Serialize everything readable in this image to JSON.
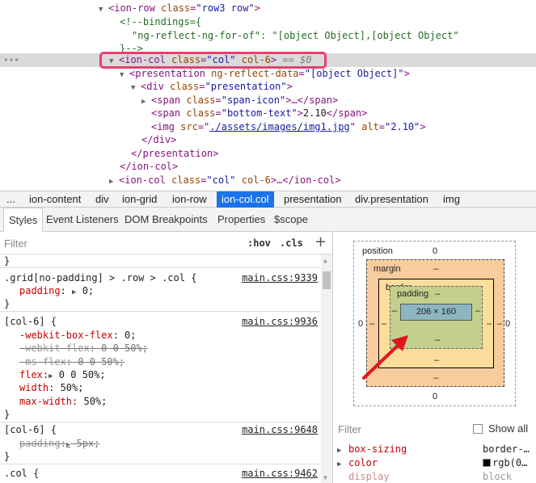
{
  "tree": {
    "lines": [
      {
        "tri": "▼",
        "t1": "<ion-row ",
        "a1n": "class",
        "a1v": "\"row3 row\"",
        "t2": ">"
      },
      {
        "c": "<!--bindings={"
      },
      {
        "c": "\"ng-reflect-ng-for-of\": \"[object Object],[object Object\""
      },
      {
        "c": "}-->"
      },
      {
        "tri": "▼",
        "t1": "<ion-col ",
        "a1n": "class",
        "a1v": "\"col\"",
        "a2n": " col-6",
        "t2": ">",
        "extra": " == $0"
      },
      {
        "tri": "▼",
        "t1": "<presentation ",
        "a1n": "ng-reflect-data",
        "a1v": "\"[object Object]\"",
        "t2": ">"
      },
      {
        "tri": "▼",
        "t1": "<div ",
        "a1n": "class",
        "a1v": "\"presentation\"",
        "t2": ">"
      },
      {
        "tri": "▶",
        "t1": "<span ",
        "a1n": "class",
        "a1v": "\"span-icon\"",
        "t2": ">…</span>"
      },
      {
        "t1": "<span ",
        "a1n": "class",
        "a1v": "\"bottom-text\"",
        "t2": ">",
        "text": "2.10",
        "t3": "</span>"
      },
      {
        "t1": "<img ",
        "a1n": "src",
        "link": "./assets/images/img1.jpg",
        "a3n": " alt",
        "a3v": "\"2.10\"",
        "t2": ">"
      },
      {
        "t1": "</div>"
      },
      {
        "t1": "</presentation>"
      },
      {
        "t1": "</ion-col>"
      },
      {
        "tri": "▶",
        "t1": "<ion-col ",
        "a1n": "class",
        "a1v": "\"col\"",
        "a2n": " col-6",
        "t2": ">…</ion-col>"
      }
    ],
    "dots": "•••"
  },
  "breadcrumbs": [
    "...",
    "ion-content",
    "div",
    "ion-grid",
    "ion-row",
    "ion-col.col",
    "presentation",
    "div.presentation",
    "img"
  ],
  "tabs": [
    "Styles",
    "Event Listeners",
    "DOM Breakpoints",
    "Properties",
    "$scope"
  ],
  "styles": {
    "filter_placeholder": "Filter",
    "hov": ":hov",
    "cls": ".cls",
    "plus": "+",
    "top_brace": "}",
    "rules": [
      {
        "selector": ".grid[no-padding] > .row > .col {",
        "source": "main.css:9339",
        "props": [
          {
            "name": "padding",
            "arrow": "▶",
            "value": "0;"
          }
        ],
        "close": "}"
      },
      {
        "selector": "[col-6] {",
        "source": "main.css:9936",
        "props": [
          {
            "name": "-webkit-box-flex",
            "value": "0;"
          },
          {
            "name": "-webkit-flex",
            "value": "0 0 50%;",
            "strike": true
          },
          {
            "name": "-ms-flex",
            "value": "0 0 50%;",
            "strike": true
          },
          {
            "name": "flex",
            "arrow": "▶",
            "value": "0 0 50%;"
          },
          {
            "name": "width",
            "value": "50%;"
          },
          {
            "name": "max-width",
            "value": "50%;"
          }
        ],
        "close": "}"
      },
      {
        "selector": "[col-6] {",
        "source": "main.css:9648",
        "props": [
          {
            "name": "padding",
            "arrow": "▶",
            "value": "5px;",
            "strike": true
          }
        ],
        "close": "}"
      },
      {
        "selector": ".col {",
        "source": "main.css:9462",
        "props": []
      }
    ]
  },
  "boxmodel": {
    "position_label": "position",
    "position_val": "0",
    "margin_label": "margin",
    "margin_val": "–",
    "border_label": "border",
    "border_val": "–",
    "padding_label": "padding",
    "padding_val": "–",
    "content": "206 × 160",
    "dash": "–",
    "zero": "0"
  },
  "computed": {
    "filter_placeholder": "Filter",
    "show_all": "Show all",
    "props": [
      {
        "name": "box-sizing",
        "value": "border-…"
      },
      {
        "name": "color",
        "value": "rgb(0…",
        "swatch": "#000000"
      },
      {
        "name": "display",
        "value": "block"
      }
    ]
  },
  "colors": {
    "highlight": "#e83f6f",
    "arrow": "#e0161e",
    "active_crumb": "#1a73e8"
  }
}
